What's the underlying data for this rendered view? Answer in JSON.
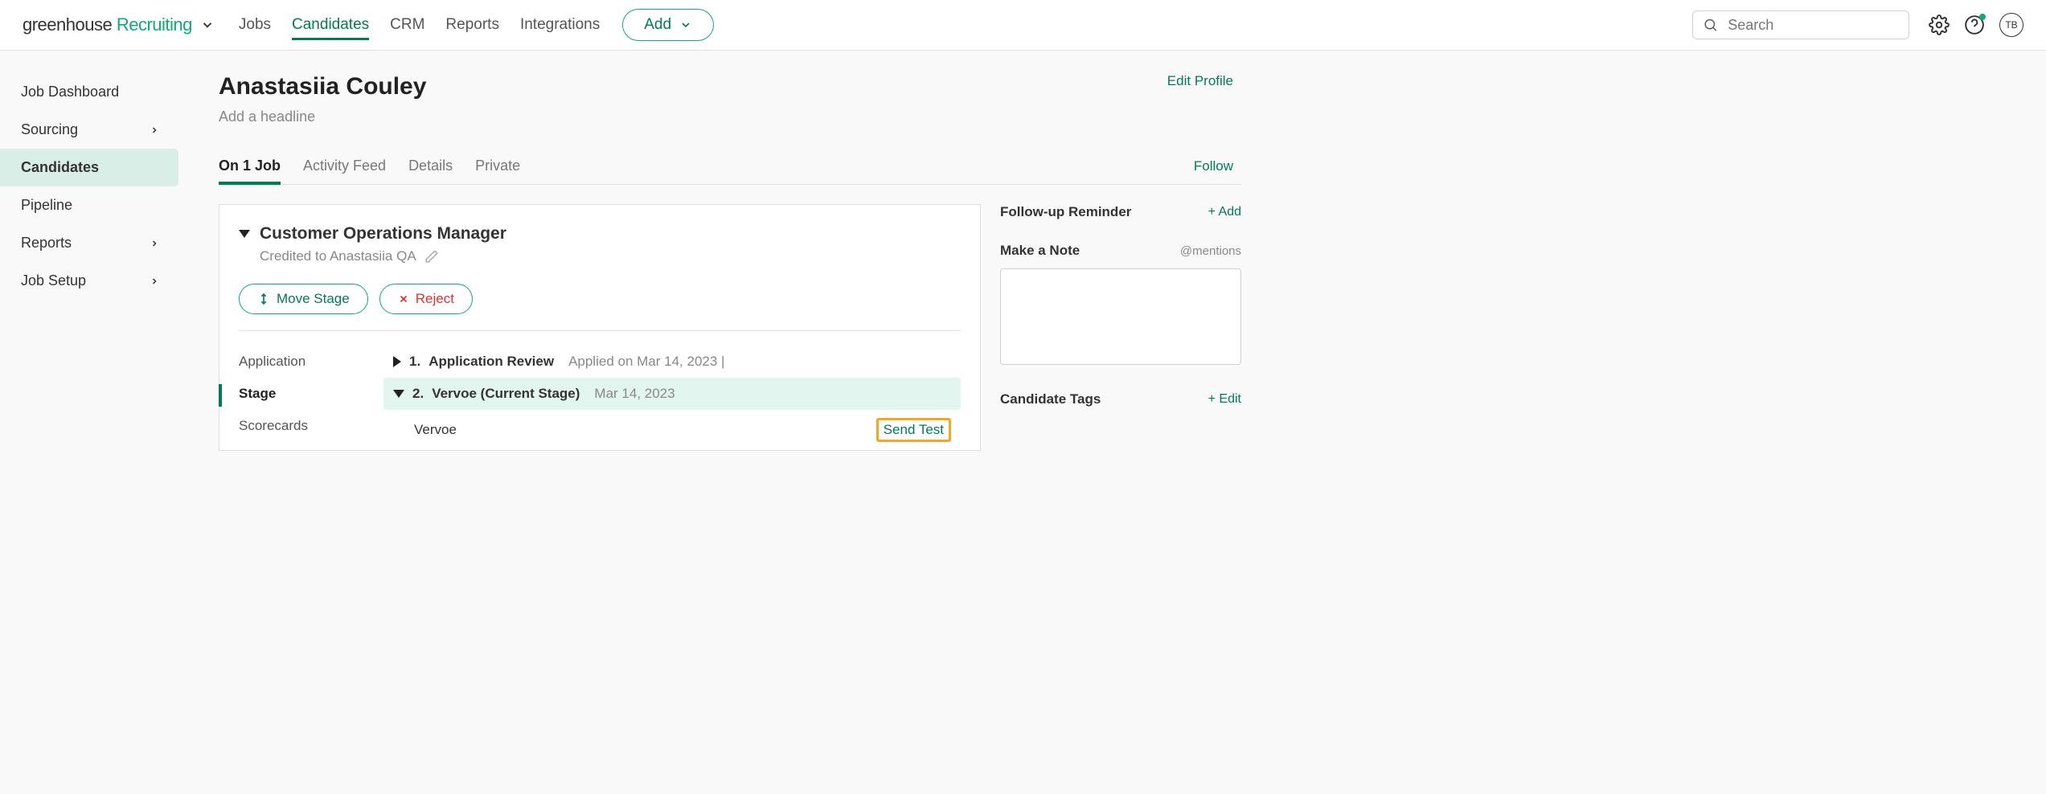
{
  "topnav": {
    "logo_part1": "greenhouse",
    "logo_part2": " Recruiting",
    "links": [
      "Jobs",
      "Candidates",
      "CRM",
      "Reports",
      "Integrations"
    ],
    "active_link": "Candidates",
    "add_label": "Add",
    "search_placeholder": "Search",
    "avatar_initials": "TB"
  },
  "sidebar": {
    "items": [
      {
        "label": "Job Dashboard",
        "expandable": false
      },
      {
        "label": "Sourcing",
        "expandable": true
      },
      {
        "label": "Candidates",
        "expandable": false,
        "active": true
      },
      {
        "label": "Pipeline",
        "expandable": false
      },
      {
        "label": "Reports",
        "expandable": true
      },
      {
        "label": "Job Setup",
        "expandable": true
      }
    ]
  },
  "candidate": {
    "name": "Anastasiia Couley",
    "headline_placeholder": "Add a headline",
    "edit_label": "Edit Profile",
    "follow_label": "Follow"
  },
  "tabs": {
    "items": [
      "On 1 Job",
      "Activity Feed",
      "Details",
      "Private"
    ],
    "active": "On 1 Job"
  },
  "job": {
    "title": "Customer Operations Manager",
    "credited_to": "Credited to Anastasiia QA",
    "move_label": "Move Stage",
    "reject_label": "Reject",
    "stage_nav": [
      "Application",
      "Stage",
      "Scorecards"
    ],
    "stage_nav_active": "Stage",
    "stages": [
      {
        "num": "1.",
        "name": "Application Review",
        "meta": "Applied on Mar 14, 2023 |",
        "expanded": false
      },
      {
        "num": "2.",
        "name": "Vervoe (Current Stage)",
        "meta": "Mar 14, 2023",
        "expanded": true,
        "current": true
      }
    ],
    "sub_item_label": "Vervoe",
    "send_test_label": "Send Test"
  },
  "rightcol": {
    "followup_title": "Follow-up Reminder",
    "followup_action": "+ Add",
    "note_title": "Make a Note",
    "note_mentions": "@mentions",
    "tags_title": "Candidate Tags",
    "tags_action": "+ Edit"
  }
}
